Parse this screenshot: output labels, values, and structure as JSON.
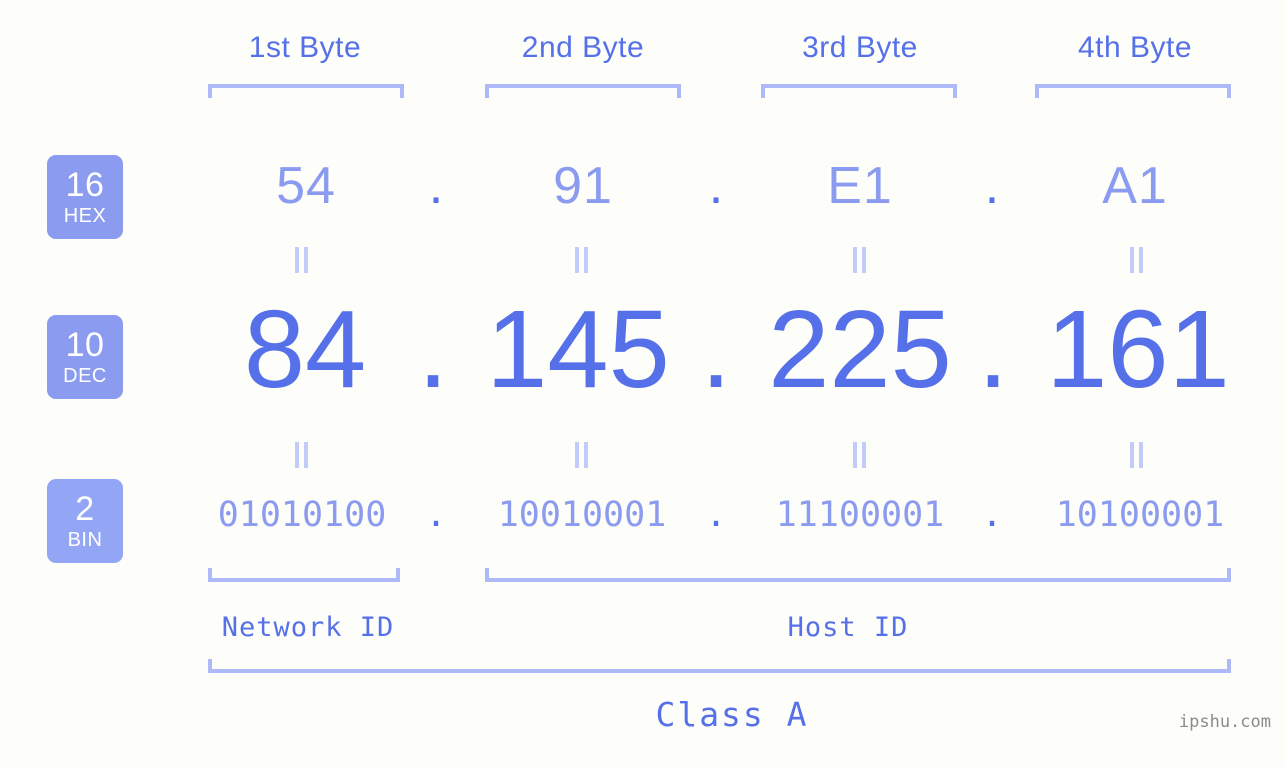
{
  "ip": {
    "decimal": "84.145.225.161",
    "class": "Class A"
  },
  "header": {
    "byte_labels": [
      "1st Byte",
      "2nd Byte",
      "3rd Byte",
      "4th Byte"
    ]
  },
  "rows": {
    "hex": {
      "badge_number": "16",
      "badge_label": "HEX",
      "values": [
        "54",
        "91",
        "E1",
        "A1"
      ],
      "separator": "."
    },
    "dec": {
      "badge_number": "10",
      "badge_label": "DEC",
      "values": [
        "84",
        "145",
        "225",
        "161"
      ],
      "separator": "."
    },
    "bin": {
      "badge_number": "2",
      "badge_label": "BIN",
      "values": [
        "01010100",
        "10010001",
        "11100001",
        "10100001"
      ],
      "separator": "."
    }
  },
  "segments": {
    "network_id": "Network ID",
    "host_id": "Host ID",
    "class_label": "Class A"
  },
  "watermark": "ipshu.com",
  "colors": {
    "background": "#fdfdfa",
    "accent_deep": "#5570e8",
    "accent_light": "#8b9bf0",
    "bracket": "#aeb9f8",
    "connector": "#c2cbfa",
    "watermark": "#8b8b8b"
  }
}
